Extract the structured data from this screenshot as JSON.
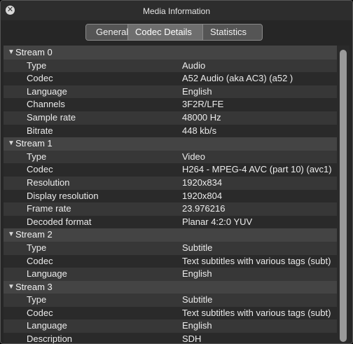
{
  "window": {
    "title": "Media Information",
    "close_glyph": "✕"
  },
  "tabs": [
    "General",
    "Codec Details",
    "Statistics"
  ],
  "active_tab": "Codec Details",
  "streams": [
    {
      "label": "Stream 0",
      "rows": [
        {
          "key": "Type",
          "value": "Audio"
        },
        {
          "key": "Codec",
          "value": "A52 Audio (aka AC3) (a52 )"
        },
        {
          "key": "Language",
          "value": "English"
        },
        {
          "key": "Channels",
          "value": "3F2R/LFE"
        },
        {
          "key": "Sample rate",
          "value": "48000 Hz"
        },
        {
          "key": "Bitrate",
          "value": "448 kb/s"
        }
      ]
    },
    {
      "label": "Stream 1",
      "rows": [
        {
          "key": "Type",
          "value": "Video"
        },
        {
          "key": "Codec",
          "value": "H264 - MPEG-4 AVC (part 10) (avc1)"
        },
        {
          "key": "Resolution",
          "value": "1920x834"
        },
        {
          "key": "Display resolution",
          "value": "1920x804"
        },
        {
          "key": "Frame rate",
          "value": "23.976216"
        },
        {
          "key": "Decoded format",
          "value": "Planar 4:2:0 YUV"
        }
      ]
    },
    {
      "label": "Stream 2",
      "rows": [
        {
          "key": "Type",
          "value": "Subtitle"
        },
        {
          "key": "Codec",
          "value": "Text subtitles with various tags (subt)"
        },
        {
          "key": "Language",
          "value": "English"
        }
      ]
    },
    {
      "label": "Stream 3",
      "rows": [
        {
          "key": "Type",
          "value": "Subtitle"
        },
        {
          "key": "Codec",
          "value": "Text subtitles with various tags (subt)"
        },
        {
          "key": "Language",
          "value": "English"
        },
        {
          "key": "Description",
          "value": "SDH"
        }
      ]
    }
  ],
  "colors": {
    "window_bg": "#262626",
    "header_row": "#444444",
    "row_odd": "#373737",
    "row_even": "#2a2a2a",
    "text": "#ececec"
  },
  "icons": {
    "close": "close-icon",
    "disclosure": "disclosure-triangle-down-icon"
  }
}
